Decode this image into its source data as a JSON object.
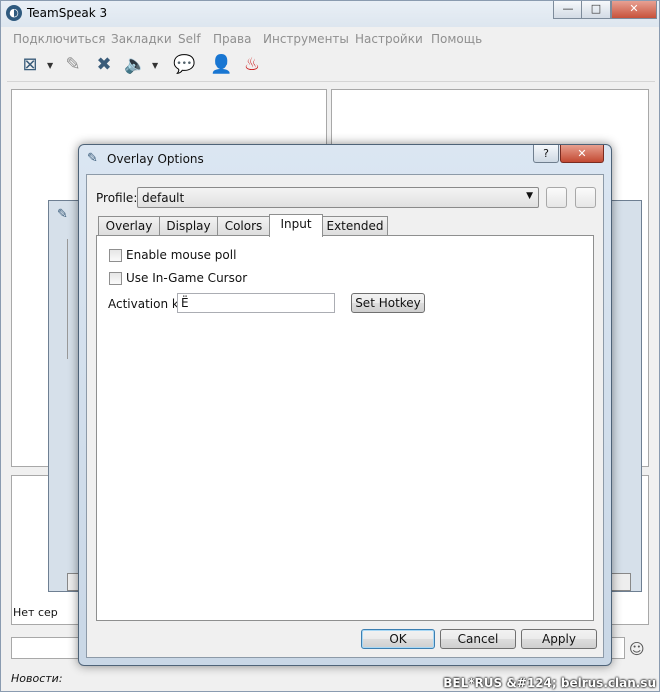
{
  "main_window": {
    "title": "TeamSpeak 3",
    "minimize": "—",
    "maximize": "□",
    "close": "✕",
    "menu": [
      "Подключиться",
      "Закладки",
      "Self",
      "Права",
      "Инструменты",
      "Настройки",
      "Помощь"
    ],
    "toolbar_icons": [
      "disconnect-icon",
      "away-icon",
      "mute-mic-icon",
      "mute-speaker-icon",
      "chat-icon",
      "contacts-icon",
      "flame-icon"
    ],
    "status_prefix": "Нет сер",
    "news_label": "Новости:"
  },
  "overlay_dialog": {
    "title": "Overlay Options",
    "help_button": "?",
    "close_button": "✕",
    "profile_label": "Profile:",
    "profile_value": "default",
    "tabs": [
      "Overlay",
      "Display",
      "Colors",
      "Input",
      "Extended"
    ],
    "active_tab": "Input",
    "input_tab": {
      "enable_mouse_poll": "Enable mouse poll",
      "use_ingame_cursor": "Use In-Game Cursor",
      "activation_key_label": "Activation key:",
      "activation_key_value": "Ё",
      "set_hotkey": "Set Hotkey"
    },
    "buttons": {
      "ok": "OK",
      "cancel": "Cancel",
      "apply": "Apply"
    }
  },
  "watermark": "BEL*RUS &#124; belrus.clan.su"
}
